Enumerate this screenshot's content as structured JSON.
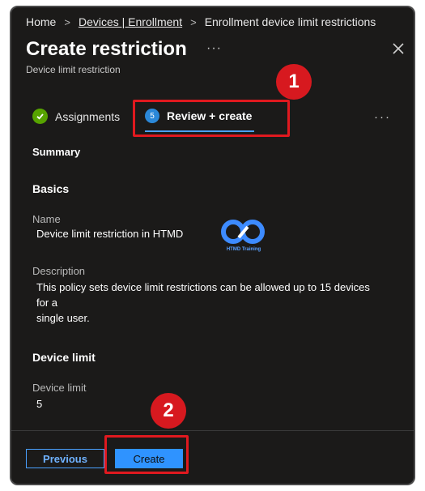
{
  "breadcrumb": {
    "home": "Home",
    "link": "Devices | Enrollment",
    "separator": ">",
    "current": "Enrollment device limit restrictions"
  },
  "header": {
    "title": "Create restriction",
    "more": "···",
    "subtitle": "Device limit restriction",
    "close_icon": "close-icon"
  },
  "tabs": [
    {
      "label": "Assignments",
      "icon": "check-icon",
      "state": "completed"
    },
    {
      "label": "Review + create",
      "step": "5",
      "state": "active"
    }
  ],
  "tab_more": "···",
  "annotations": [
    {
      "number": "1"
    },
    {
      "number": "2"
    }
  ],
  "summary": {
    "heading": "Summary",
    "basics": {
      "heading": "Basics",
      "name_label": "Name",
      "name_value": "Device limit restriction in HTMD",
      "description_label": "Description",
      "description_lines": [
        "This policy sets device limit restrictions can be allowed up to 15 devices",
        "for a",
        "single user."
      ]
    },
    "device_limit": {
      "heading": "Device limit",
      "label": "Device limit",
      "value": "5"
    }
  },
  "watermark": {
    "text": "HTMD Training"
  },
  "footer": {
    "previous_label": "Previous",
    "create_label": "Create"
  },
  "colors": {
    "background": "#1b1a19",
    "accent": "#2f93ff",
    "highlight": "#e0191f",
    "success": "#57a300"
  }
}
